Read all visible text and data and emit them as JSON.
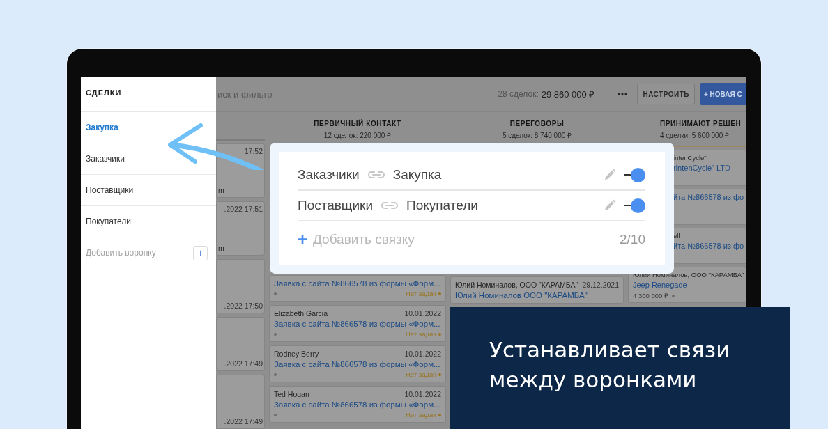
{
  "sidebar": {
    "title": "СДЕЛКИ",
    "items": [
      {
        "label": "Закупка",
        "selected": true
      },
      {
        "label": "Заказчики",
        "selected": false
      },
      {
        "label": "Поставщики",
        "selected": false
      },
      {
        "label": "Покупатели",
        "selected": false
      }
    ],
    "add_label": "Добавить воронку",
    "add_button": "+"
  },
  "toolbar": {
    "search": "иск и фильтр",
    "count_label": "28 сделок:",
    "total": "29 860 000 ₽",
    "settings_button": "НАСТРОИТЬ",
    "new_button": "+ НОВАЯ С"
  },
  "columns": [
    {
      "cards": [
        {
          "date": "17:52",
          "contact": "m"
        },
        {
          "date": ".2022 17:51",
          "contact": "m"
        },
        {
          "date": ".2022 17:50"
        },
        {
          "date": ".2022 17:49"
        },
        {
          "date": ".2022 17:49"
        }
      ]
    },
    {
      "title": "ПЕРВИЧНЫЙ КОНТАКТ",
      "summary": "12 сделок: 220 000 ₽",
      "cards": [
        {
          "title": "Заявка с сайта №866578 из формы «Форм...",
          "tasks": "Нет задач"
        },
        {
          "contact": "Elizabeth Garcia",
          "date": "10.01.2022",
          "title": "Заявка с сайта №866578 из формы «Форм...",
          "tasks": "Нет задач"
        },
        {
          "contact": "Rodney Berry",
          "date": "10.01.2022",
          "title": "Заявка с сайта №866578 из формы «Форм...",
          "tasks": "Нет задач"
        },
        {
          "contact": "Ted Hogan",
          "date": "10.01.2022",
          "title": "Заявка с сайта №866578 из формы «Форм...",
          "tasks": "Нет задач"
        }
      ]
    },
    {
      "title": "ПЕРЕГОВОРЫ",
      "summary": "5 сделок: 8 740 000 ₽",
      "cards": [
        {
          "contact": "Юлий Номиналов, ООО \"КАРАМБА\"",
          "date": "29.12.2021",
          "title": "Юлий Номиналов ООО \"КАРАМБА\""
        }
      ]
    },
    {
      "title": "ПРИНИМАЮТ РЕШЕН",
      "summary": "4 сделки: 5 600 000 ₽",
      "cards": [
        {
          "contact": "intenCycle\"",
          "title": "rintenCycle\" LTD"
        },
        {
          "title": "йта №866578 из фо"
        },
        {
          "contact": "ell",
          "title": "йта №866578 из фо"
        },
        {
          "contact": "Юлий Номиналов, ООО \"КАРАМБА\"",
          "title": "Jeep Renegade",
          "price": "4 300 000 ₽"
        }
      ]
    }
  ],
  "links_popup": {
    "links": [
      {
        "from": "Заказчики",
        "to": "Закупка",
        "on": true
      },
      {
        "from": "Поставщики",
        "to": "Покупатели",
        "on": true
      }
    ],
    "add_icon": "+",
    "add_label": "Добавить связку",
    "counter": "2/10"
  },
  "banner": {
    "text": "Устанавливает связи между воронками"
  }
}
